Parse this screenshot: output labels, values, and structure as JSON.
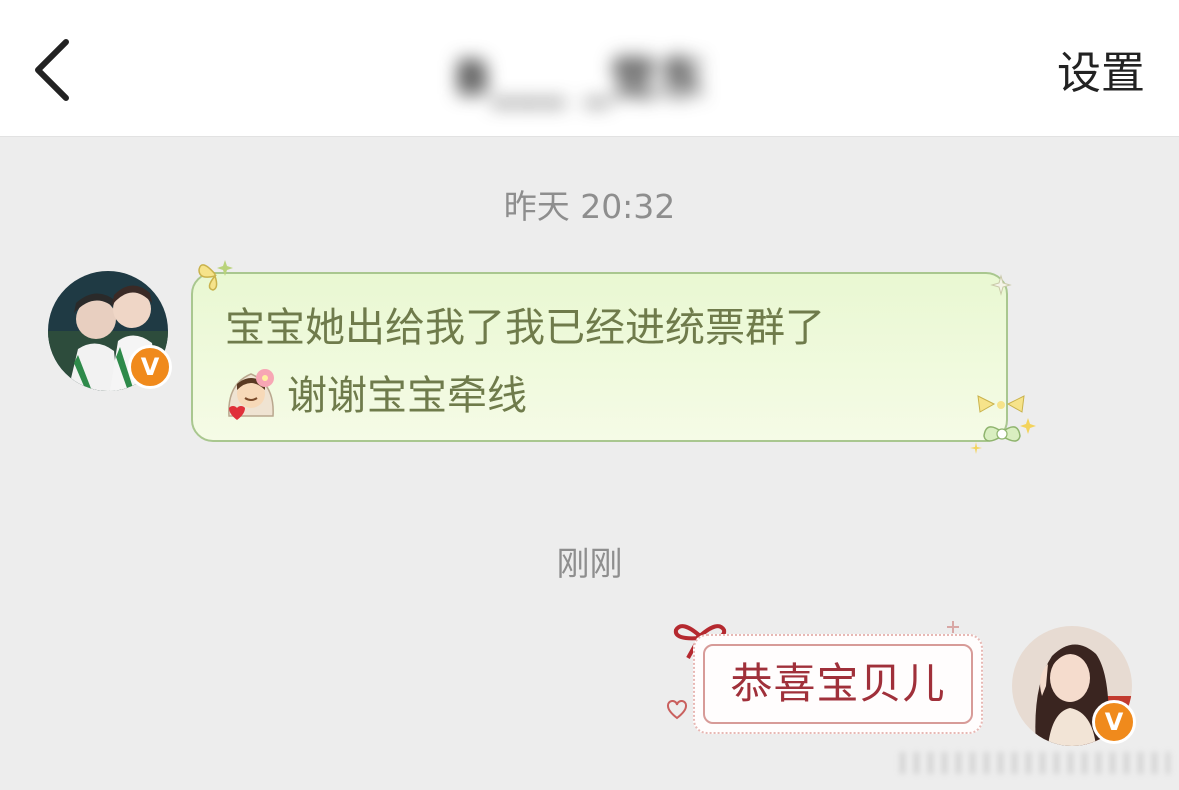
{
  "header": {
    "title": "B___ _觉东",
    "settings_label": "设置"
  },
  "messages": [
    {
      "timestamp": "昨天 20:32",
      "direction": "incoming",
      "lines": [
        "宝宝她出给我了我已经进统票群了",
        "谢谢宝宝牵线"
      ],
      "bubble_style": "green-cute"
    },
    {
      "timestamp": "刚刚",
      "direction": "outgoing",
      "text": "恭喜宝贝儿",
      "bubble_style": "red-bow"
    }
  ],
  "badges": {
    "verified_letter": "V",
    "color": "#f08a1c"
  },
  "colors": {
    "background": "#ededed",
    "incoming_text": "#6f7b4b",
    "outgoing_text": "#a0303a"
  }
}
